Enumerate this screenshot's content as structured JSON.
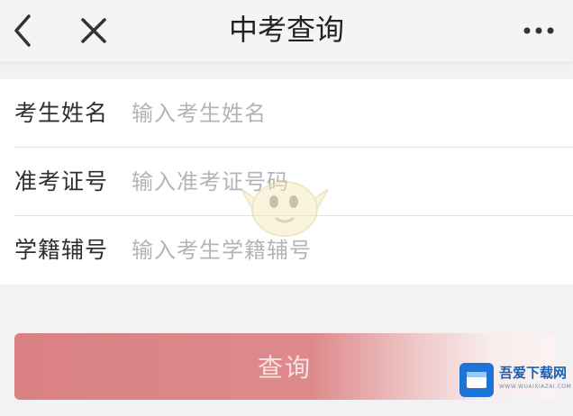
{
  "header": {
    "title": "中考查询",
    "back_icon": "chevron-left-icon",
    "close_icon": "close-icon",
    "more_icon": "more-horizontal-icon"
  },
  "form": {
    "fields": [
      {
        "label": "考生姓名",
        "placeholder": "输入考生姓名",
        "value": ""
      },
      {
        "label": "准考证号",
        "placeholder": "输入准考证号码",
        "value": ""
      },
      {
        "label": "学籍辅号",
        "placeholder": "输入考生学籍辅号",
        "value": ""
      }
    ]
  },
  "query_button": {
    "label": "查询",
    "color": "#d98184"
  },
  "watermark_logo": {
    "name": "吾爱下载网",
    "domain": "WWW.WUAIXIAZAI.COM",
    "color": "#1e74d6"
  }
}
